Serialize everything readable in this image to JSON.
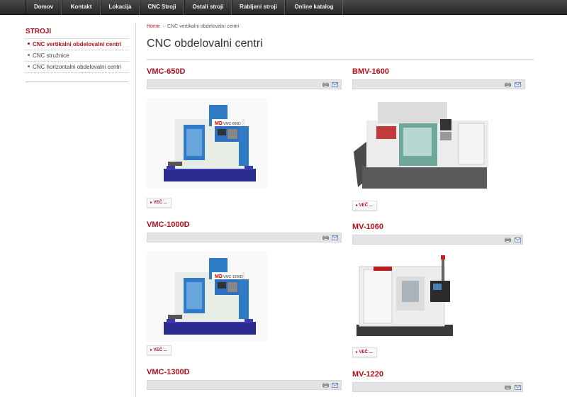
{
  "nav": {
    "items": [
      "Domov",
      "Kontakt",
      "Lokacija",
      "CNC Stroji",
      "Ostali stroji",
      "Rabljeni stroji",
      "Online katalog"
    ]
  },
  "sidebar": {
    "title": "STROJI",
    "items": [
      {
        "label": "CNC vertikalni obdelovalni centri",
        "active": true
      },
      {
        "label": "CNC stružnice",
        "active": false
      },
      {
        "label": "CNC horizontalni obdelovalni centri",
        "active": false
      }
    ]
  },
  "breadcrumb": {
    "home": "Home",
    "separator": "›",
    "current": "CNC vertikalni obdelovalni centri"
  },
  "page": {
    "title": "CNC obdelovalni centri"
  },
  "products": [
    {
      "name": "VMC-650D",
      "more_label": "▸ VEČ ...",
      "image": "machine-vmc-blue",
      "plate": "VMC-650D"
    },
    {
      "name": "BMV-1600",
      "more_label": "▸ VEČ ...",
      "image": "machine-bmv-grey"
    },
    {
      "name": "VMC-1000D",
      "more_label": "▸ VEČ ...",
      "image": "machine-vmc-blue",
      "plate": "VMC-1000D"
    },
    {
      "name": "MV-1060",
      "more_label": "▸ VEČ ...",
      "image": "machine-mv-white"
    },
    {
      "name": "VMC-1300D",
      "image": "none"
    },
    {
      "name": "MV-1220",
      "image": "none"
    }
  ],
  "icons": {
    "print": "print-icon",
    "email": "email-icon"
  },
  "colors": {
    "accent": "#b3101a",
    "nav_bg": "#333333",
    "bar_bg": "#e4e4e4"
  }
}
